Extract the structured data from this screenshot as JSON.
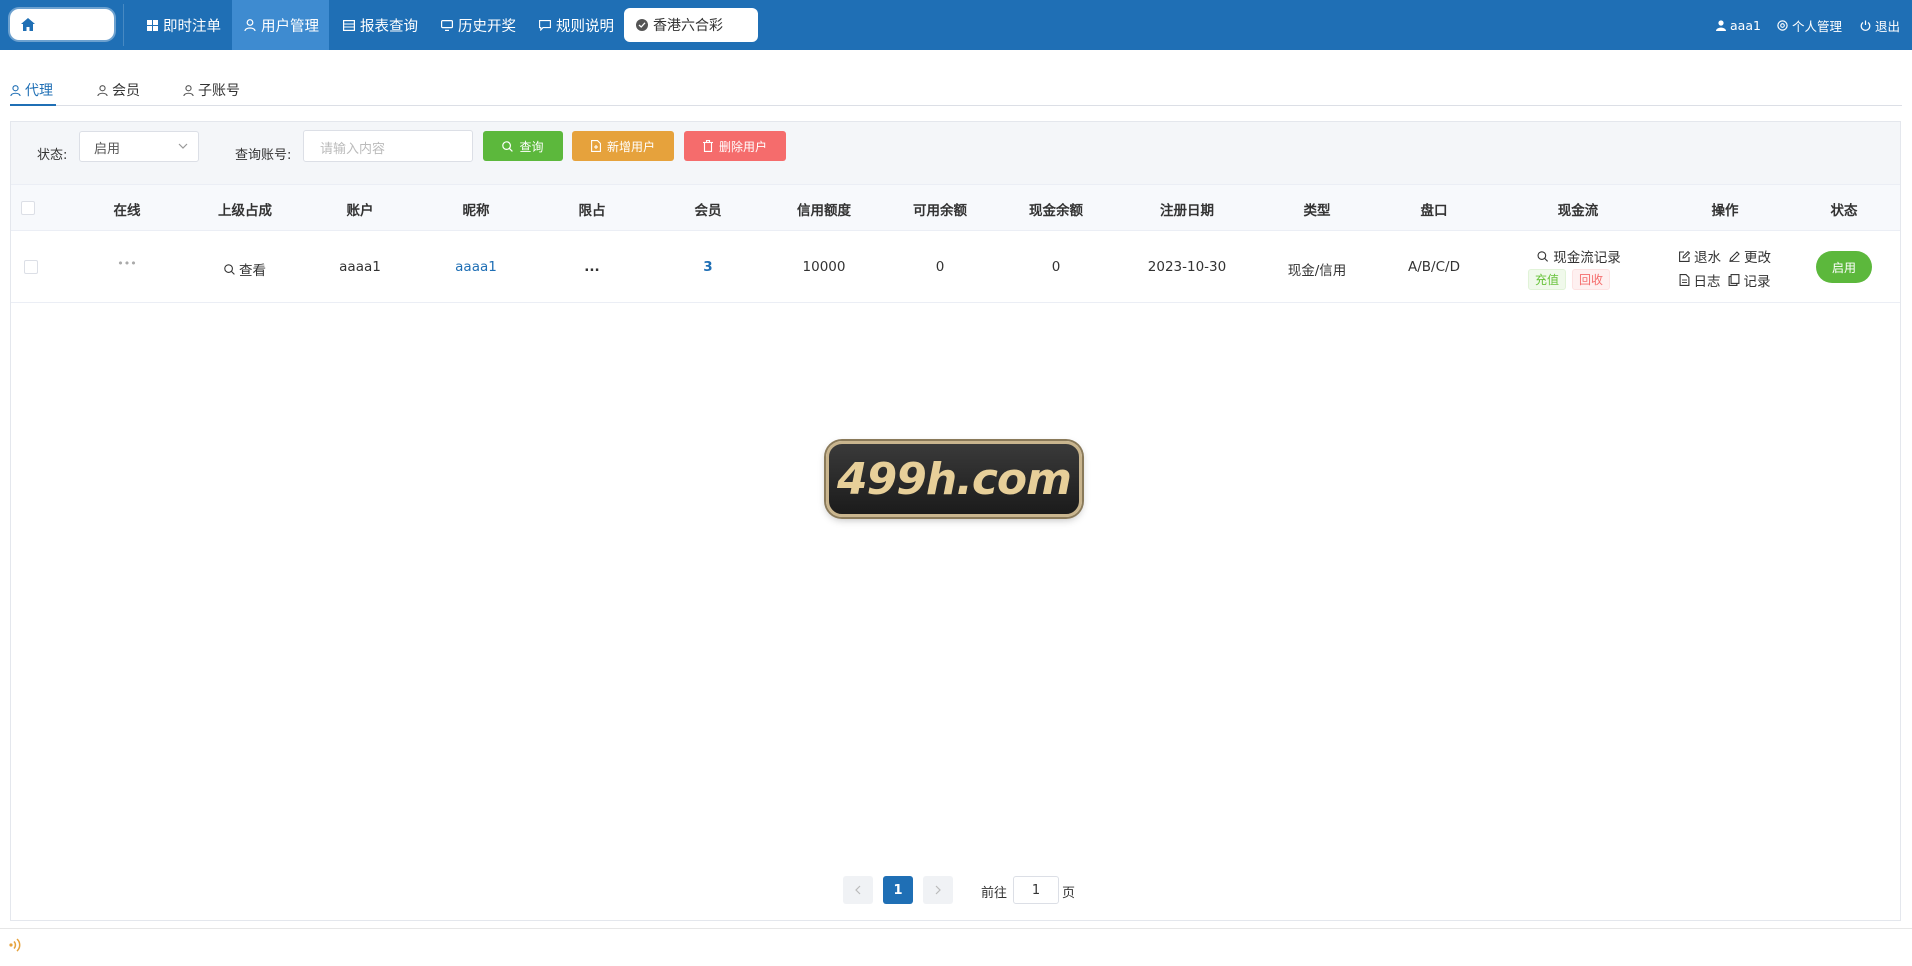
{
  "nav": {
    "items": [
      {
        "label": "即时注单",
        "icon": "grid-icon"
      },
      {
        "label": "用户管理",
        "icon": "user-icon",
        "active": true
      },
      {
        "label": "报表查询",
        "icon": "table-icon"
      },
      {
        "label": "历史开奖",
        "icon": "monitor-icon"
      },
      {
        "label": "规则说明",
        "icon": "chat-icon"
      }
    ],
    "lottery": "香港六合彩",
    "user": "aaa1",
    "profile": "个人管理",
    "logout": "退出"
  },
  "tabs": [
    {
      "label": "代理",
      "active": true
    },
    {
      "label": "会员"
    },
    {
      "label": "子账号"
    }
  ],
  "filter": {
    "status_label": "状态:",
    "status_value": "启用",
    "account_label": "查询账号:",
    "account_placeholder": "请输入内容",
    "search_btn": "查询",
    "add_btn": "新增用户",
    "delete_btn": "删除用户"
  },
  "table": {
    "headers": [
      "在线",
      "上级占成",
      "账户",
      "昵称",
      "限占",
      "会员",
      "信用额度",
      "可用余额",
      "现金余额",
      "注册日期",
      "类型",
      "盘口",
      "现金流",
      "操作",
      "状态"
    ],
    "rows": [
      {
        "online": "•••",
        "parent_share": "查看",
        "account": "aaaa1",
        "nickname": "aaaa1",
        "limit": "...",
        "members": "3",
        "credit": "10000",
        "available": "0",
        "cash": "0",
        "reg_date": "2023-10-30",
        "type": "现金/信用",
        "odds": "A/B/C/D",
        "cashflow_record": "现金流记录",
        "recharge": "充值",
        "recover": "回收",
        "op_rebate": "退水",
        "op_edit": "更改",
        "op_log": "日志",
        "op_record": "记录",
        "status": "启用"
      }
    ]
  },
  "watermark": "499h.com",
  "pagination": {
    "current": "1",
    "goto_label": "前往",
    "goto_value": "1",
    "page_suffix": "页"
  },
  "colors": {
    "primary": "#1f6fb5",
    "success": "#5cb83c",
    "warning": "#e6a23c",
    "danger": "#f56c6c"
  }
}
